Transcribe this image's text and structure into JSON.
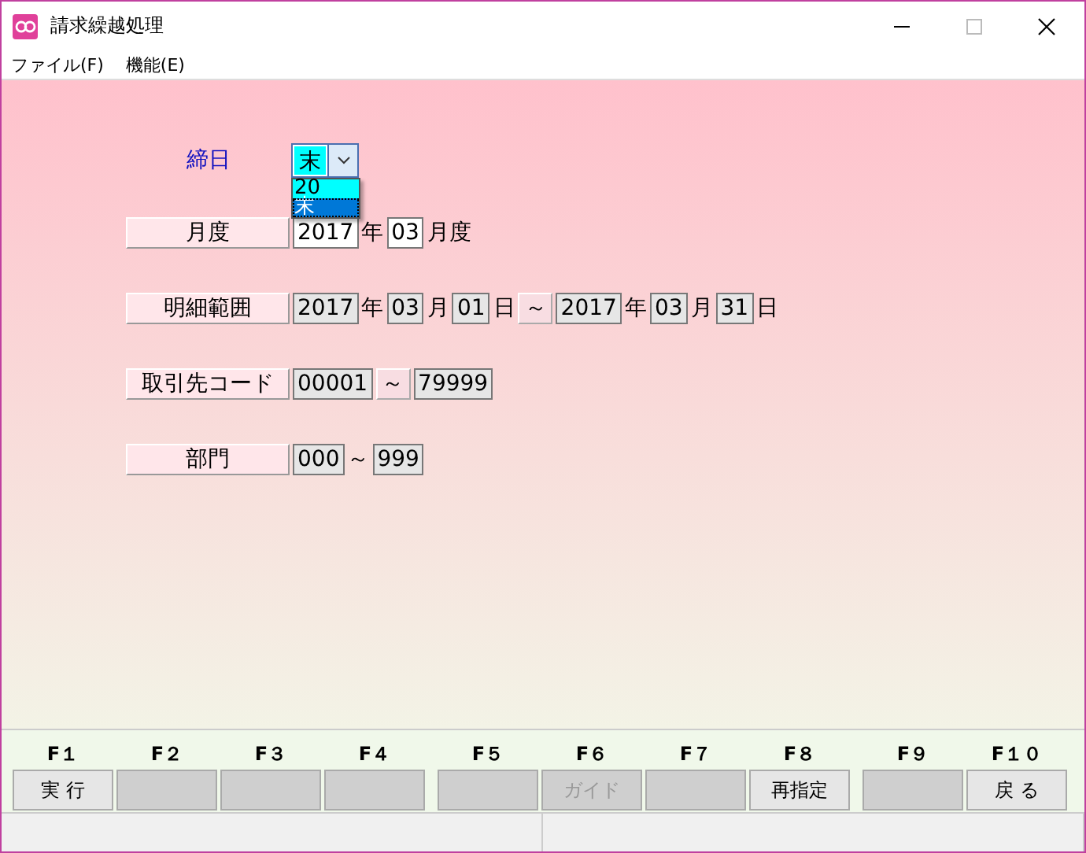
{
  "window": {
    "title": "請求繰越処理"
  },
  "menu": [
    {
      "label": "ファイル(F)"
    },
    {
      "label": "機能(E)"
    }
  ],
  "closing_day": {
    "label": "締日",
    "value": "末",
    "expanded": true,
    "options": [
      {
        "label": "20",
        "selected": false
      },
      {
        "label": "末",
        "selected": true
      }
    ]
  },
  "rows": [
    {
      "label": "月度",
      "parts": [
        {
          "kind": "field",
          "value": "2017",
          "disabled": false
        },
        {
          "kind": "unit",
          "text": "年"
        },
        {
          "kind": "field",
          "value": "03",
          "disabled": false
        },
        {
          "kind": "unit",
          "text": "月度"
        }
      ]
    },
    {
      "label": "明細範囲",
      "parts": [
        {
          "kind": "field",
          "value": "2017",
          "disabled": true
        },
        {
          "kind": "unit",
          "text": "年"
        },
        {
          "kind": "field",
          "value": "03",
          "disabled": true
        },
        {
          "kind": "unit",
          "text": "月"
        },
        {
          "kind": "field",
          "value": "01",
          "disabled": true
        },
        {
          "kind": "unit",
          "text": "日"
        },
        {
          "kind": "range",
          "text": "～"
        },
        {
          "kind": "field",
          "value": "2017",
          "disabled": true
        },
        {
          "kind": "unit",
          "text": "年"
        },
        {
          "kind": "field",
          "value": "03",
          "disabled": true
        },
        {
          "kind": "unit",
          "text": "月"
        },
        {
          "kind": "field",
          "value": "31",
          "disabled": true
        },
        {
          "kind": "unit",
          "text": "日"
        }
      ]
    },
    {
      "label": "取引先コード",
      "parts": [
        {
          "kind": "field",
          "value": "00001",
          "disabled": true
        },
        {
          "kind": "range",
          "text": "～"
        },
        {
          "kind": "field",
          "value": "79999",
          "disabled": true
        }
      ]
    },
    {
      "label": "部門",
      "parts": [
        {
          "kind": "field",
          "value": "000",
          "disabled": true
        },
        {
          "kind": "unit",
          "text": "～"
        },
        {
          "kind": "field",
          "value": "999",
          "disabled": true
        }
      ]
    }
  ],
  "fkeys": [
    {
      "key": "F１",
      "label": "実 行",
      "disabled": false
    },
    {
      "key": "F２",
      "disabled": true
    },
    {
      "key": "F３",
      "disabled": true
    },
    {
      "key": "F４",
      "disabled": true
    },
    {
      "key": "F５",
      "disabled": true
    },
    {
      "key": "F６",
      "label": "ガイド",
      "disabled": true
    },
    {
      "key": "F７",
      "disabled": true
    },
    {
      "key": "F８",
      "label": "再指定",
      "disabled": false
    },
    {
      "key": "F９",
      "disabled": true
    },
    {
      "key": "F１０",
      "label": "戻 る",
      "disabled": false
    }
  ]
}
